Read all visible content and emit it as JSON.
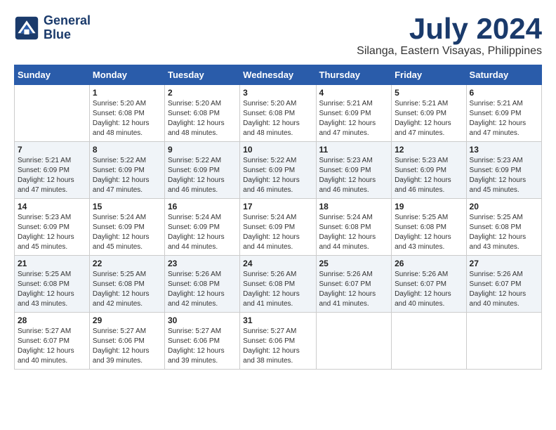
{
  "header": {
    "logo_line1": "General",
    "logo_line2": "Blue",
    "month": "July 2024",
    "location": "Silanga, Eastern Visayas, Philippines"
  },
  "weekdays": [
    "Sunday",
    "Monday",
    "Tuesday",
    "Wednesday",
    "Thursday",
    "Friday",
    "Saturday"
  ],
  "weeks": [
    [
      {
        "day": "",
        "sunrise": "",
        "sunset": "",
        "daylight": "",
        "empty": true
      },
      {
        "day": "1",
        "sunrise": "Sunrise: 5:20 AM",
        "sunset": "Sunset: 6:08 PM",
        "daylight": "Daylight: 12 hours and 48 minutes."
      },
      {
        "day": "2",
        "sunrise": "Sunrise: 5:20 AM",
        "sunset": "Sunset: 6:08 PM",
        "daylight": "Daylight: 12 hours and 48 minutes."
      },
      {
        "day": "3",
        "sunrise": "Sunrise: 5:20 AM",
        "sunset": "Sunset: 6:08 PM",
        "daylight": "Daylight: 12 hours and 48 minutes."
      },
      {
        "day": "4",
        "sunrise": "Sunrise: 5:21 AM",
        "sunset": "Sunset: 6:09 PM",
        "daylight": "Daylight: 12 hours and 47 minutes."
      },
      {
        "day": "5",
        "sunrise": "Sunrise: 5:21 AM",
        "sunset": "Sunset: 6:09 PM",
        "daylight": "Daylight: 12 hours and 47 minutes."
      },
      {
        "day": "6",
        "sunrise": "Sunrise: 5:21 AM",
        "sunset": "Sunset: 6:09 PM",
        "daylight": "Daylight: 12 hours and 47 minutes."
      }
    ],
    [
      {
        "day": "7",
        "sunrise": "Sunrise: 5:21 AM",
        "sunset": "Sunset: 6:09 PM",
        "daylight": "Daylight: 12 hours and 47 minutes."
      },
      {
        "day": "8",
        "sunrise": "Sunrise: 5:22 AM",
        "sunset": "Sunset: 6:09 PM",
        "daylight": "Daylight: 12 hours and 47 minutes."
      },
      {
        "day": "9",
        "sunrise": "Sunrise: 5:22 AM",
        "sunset": "Sunset: 6:09 PM",
        "daylight": "Daylight: 12 hours and 46 minutes."
      },
      {
        "day": "10",
        "sunrise": "Sunrise: 5:22 AM",
        "sunset": "Sunset: 6:09 PM",
        "daylight": "Daylight: 12 hours and 46 minutes."
      },
      {
        "day": "11",
        "sunrise": "Sunrise: 5:23 AM",
        "sunset": "Sunset: 6:09 PM",
        "daylight": "Daylight: 12 hours and 46 minutes."
      },
      {
        "day": "12",
        "sunrise": "Sunrise: 5:23 AM",
        "sunset": "Sunset: 6:09 PM",
        "daylight": "Daylight: 12 hours and 46 minutes."
      },
      {
        "day": "13",
        "sunrise": "Sunrise: 5:23 AM",
        "sunset": "Sunset: 6:09 PM",
        "daylight": "Daylight: 12 hours and 45 minutes."
      }
    ],
    [
      {
        "day": "14",
        "sunrise": "Sunrise: 5:23 AM",
        "sunset": "Sunset: 6:09 PM",
        "daylight": "Daylight: 12 hours and 45 minutes."
      },
      {
        "day": "15",
        "sunrise": "Sunrise: 5:24 AM",
        "sunset": "Sunset: 6:09 PM",
        "daylight": "Daylight: 12 hours and 45 minutes."
      },
      {
        "day": "16",
        "sunrise": "Sunrise: 5:24 AM",
        "sunset": "Sunset: 6:09 PM",
        "daylight": "Daylight: 12 hours and 44 minutes."
      },
      {
        "day": "17",
        "sunrise": "Sunrise: 5:24 AM",
        "sunset": "Sunset: 6:09 PM",
        "daylight": "Daylight: 12 hours and 44 minutes."
      },
      {
        "day": "18",
        "sunrise": "Sunrise: 5:24 AM",
        "sunset": "Sunset: 6:08 PM",
        "daylight": "Daylight: 12 hours and 44 minutes."
      },
      {
        "day": "19",
        "sunrise": "Sunrise: 5:25 AM",
        "sunset": "Sunset: 6:08 PM",
        "daylight": "Daylight: 12 hours and 43 minutes."
      },
      {
        "day": "20",
        "sunrise": "Sunrise: 5:25 AM",
        "sunset": "Sunset: 6:08 PM",
        "daylight": "Daylight: 12 hours and 43 minutes."
      }
    ],
    [
      {
        "day": "21",
        "sunrise": "Sunrise: 5:25 AM",
        "sunset": "Sunset: 6:08 PM",
        "daylight": "Daylight: 12 hours and 43 minutes."
      },
      {
        "day": "22",
        "sunrise": "Sunrise: 5:25 AM",
        "sunset": "Sunset: 6:08 PM",
        "daylight": "Daylight: 12 hours and 42 minutes."
      },
      {
        "day": "23",
        "sunrise": "Sunrise: 5:26 AM",
        "sunset": "Sunset: 6:08 PM",
        "daylight": "Daylight: 12 hours and 42 minutes."
      },
      {
        "day": "24",
        "sunrise": "Sunrise: 5:26 AM",
        "sunset": "Sunset: 6:08 PM",
        "daylight": "Daylight: 12 hours and 41 minutes."
      },
      {
        "day": "25",
        "sunrise": "Sunrise: 5:26 AM",
        "sunset": "Sunset: 6:07 PM",
        "daylight": "Daylight: 12 hours and 41 minutes."
      },
      {
        "day": "26",
        "sunrise": "Sunrise: 5:26 AM",
        "sunset": "Sunset: 6:07 PM",
        "daylight": "Daylight: 12 hours and 40 minutes."
      },
      {
        "day": "27",
        "sunrise": "Sunrise: 5:26 AM",
        "sunset": "Sunset: 6:07 PM",
        "daylight": "Daylight: 12 hours and 40 minutes."
      }
    ],
    [
      {
        "day": "28",
        "sunrise": "Sunrise: 5:27 AM",
        "sunset": "Sunset: 6:07 PM",
        "daylight": "Daylight: 12 hours and 40 minutes."
      },
      {
        "day": "29",
        "sunrise": "Sunrise: 5:27 AM",
        "sunset": "Sunset: 6:06 PM",
        "daylight": "Daylight: 12 hours and 39 minutes."
      },
      {
        "day": "30",
        "sunrise": "Sunrise: 5:27 AM",
        "sunset": "Sunset: 6:06 PM",
        "daylight": "Daylight: 12 hours and 39 minutes."
      },
      {
        "day": "31",
        "sunrise": "Sunrise: 5:27 AM",
        "sunset": "Sunset: 6:06 PM",
        "daylight": "Daylight: 12 hours and 38 minutes."
      },
      {
        "day": "",
        "sunrise": "",
        "sunset": "",
        "daylight": "",
        "empty": true
      },
      {
        "day": "",
        "sunrise": "",
        "sunset": "",
        "daylight": "",
        "empty": true
      },
      {
        "day": "",
        "sunrise": "",
        "sunset": "",
        "daylight": "",
        "empty": true
      }
    ]
  ]
}
